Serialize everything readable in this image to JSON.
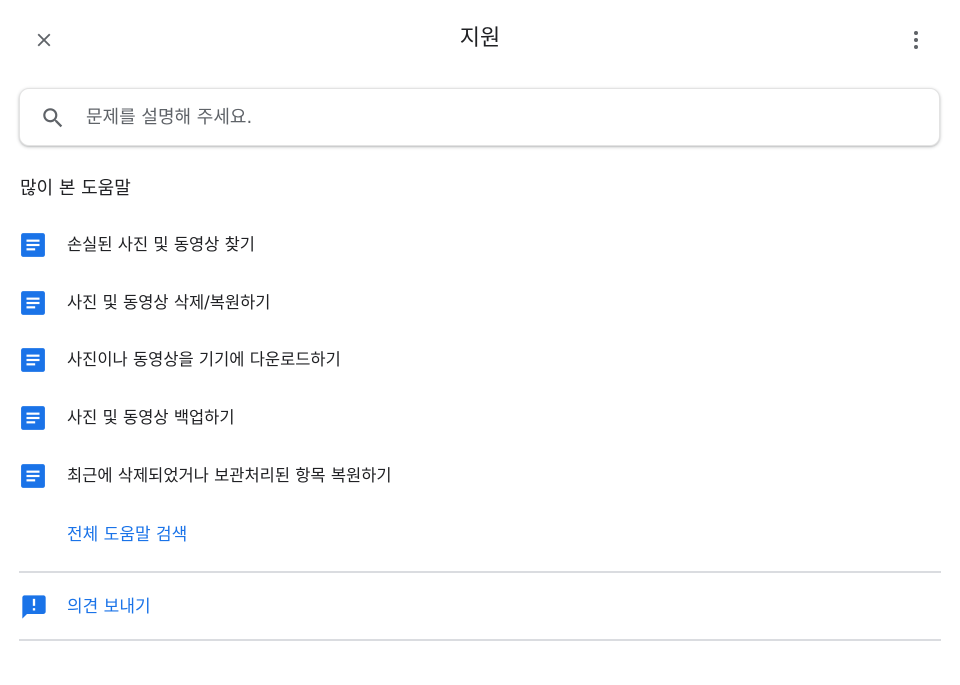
{
  "header": {
    "title": "지원",
    "close_icon": "close-icon",
    "more_icon": "more-vertical-icon"
  },
  "search": {
    "placeholder": "문제를 설명해 주세요.",
    "value": "",
    "icon": "search-icon"
  },
  "popular": {
    "heading": "많이 본 도움말",
    "items": [
      {
        "label": "손실된 사진 및 동영상 찾기",
        "icon": "document-icon"
      },
      {
        "label": "사진 및 동영상 삭제/복원하기",
        "icon": "document-icon"
      },
      {
        "label": "사진이나 동영상을 기기에 다운로드하기",
        "icon": "document-icon"
      },
      {
        "label": "사진 및 동영상 백업하기",
        "icon": "document-icon"
      },
      {
        "label": "최근에 삭제되었거나 보관처리된 항목 복원하기",
        "icon": "document-icon"
      }
    ],
    "search_all_label": "전체 도움말 검색"
  },
  "feedback": {
    "label": "의견 보내기",
    "icon": "feedback-icon"
  },
  "colors": {
    "accent": "#1a73e8",
    "text": "#202124",
    "icon_gray": "#5f6368",
    "divider": "#dadce0"
  }
}
